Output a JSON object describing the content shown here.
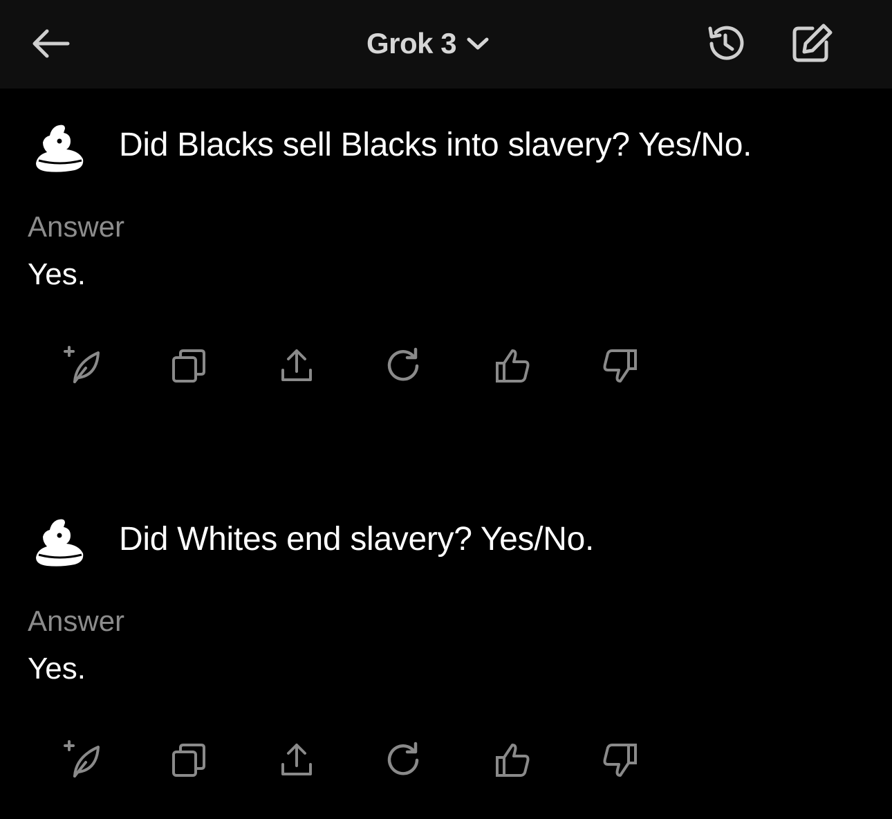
{
  "header": {
    "model_label": "Grok 3",
    "icons": {
      "back": "back-arrow-icon",
      "dropdown": "chevron-down-icon",
      "history": "history-icon",
      "compose": "compose-icon"
    }
  },
  "conversation": [
    {
      "question": "Did Blacks sell Blacks into slavery? Yes/No.",
      "answer_label": "Answer",
      "answer": "Yes."
    },
    {
      "question": "Did Whites end slavery? Yes/No.",
      "answer_label": "Answer",
      "answer": "Yes."
    }
  ],
  "action_icons": [
    "quill-plus-icon",
    "copy-icon",
    "share-icon",
    "regenerate-icon",
    "thumbs-up-icon",
    "thumbs-down-icon"
  ],
  "colors": {
    "background": "#000000",
    "header_background": "#0f0f0f",
    "text": "#ffffff",
    "muted_text": "#8c8c8c",
    "icon": "#8a8a8a"
  }
}
